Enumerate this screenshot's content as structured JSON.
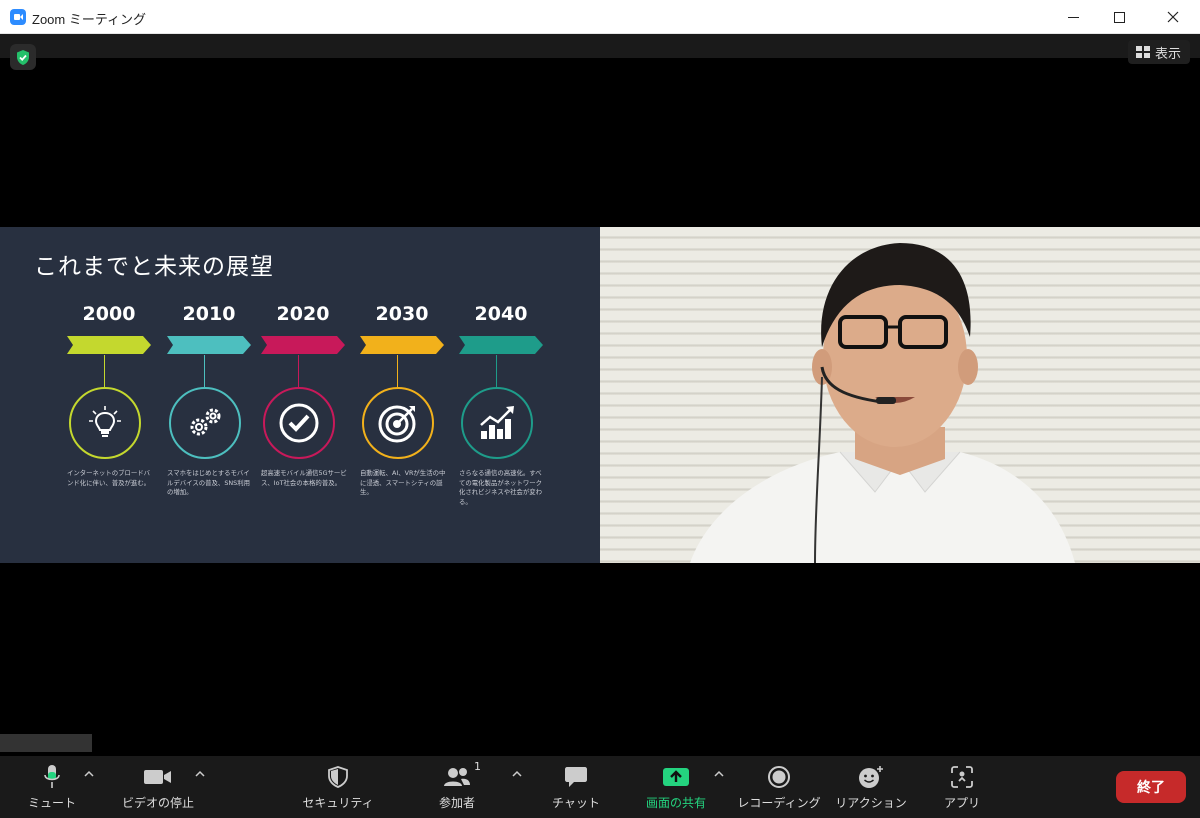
{
  "window": {
    "title": "Zoom ミーティング"
  },
  "meeting_top": {
    "view_label": "表示"
  },
  "slide": {
    "title": "これまでと未来の展望",
    "timeline": [
      {
        "year": "2000",
        "color": "#C4D82E",
        "icon": "lightbulb-icon",
        "desc": "インターネットのブロードバンド化に伴い、普及が進む。"
      },
      {
        "year": "2010",
        "color": "#4DBFBF",
        "icon": "gears-icon",
        "desc": "スマホをはじめとするモバイルデバイスの普及、SNS利用の増加。"
      },
      {
        "year": "2020",
        "color": "#C8195A",
        "icon": "checkmark-icon",
        "desc": "超高速モバイル通信5Gサービス、IoT社会の本格的普及。"
      },
      {
        "year": "2030",
        "color": "#F2B11B",
        "icon": "target-icon",
        "desc": "自動運転、AI、VRが生活の中に浸透、スマートシティの誕生。"
      },
      {
        "year": "2040",
        "color": "#1E9C8A",
        "icon": "growth-chart-icon",
        "desc": "さらなる通信の高速化。すべての電化製品がネットワーク化されビジネスや社会が変わる。"
      }
    ]
  },
  "toolbar": {
    "mute": "ミュート",
    "video": "ビデオの停止",
    "security": "セキュリティ",
    "participants": "参加者",
    "participants_count": "1",
    "chat": "チャット",
    "share": "画面の共有",
    "record": "レコーディング",
    "reaction": "リアクション",
    "apps": "アプリ",
    "end": "終了",
    "share_color": "#24D37F",
    "end_color": "#C62A2A"
  }
}
